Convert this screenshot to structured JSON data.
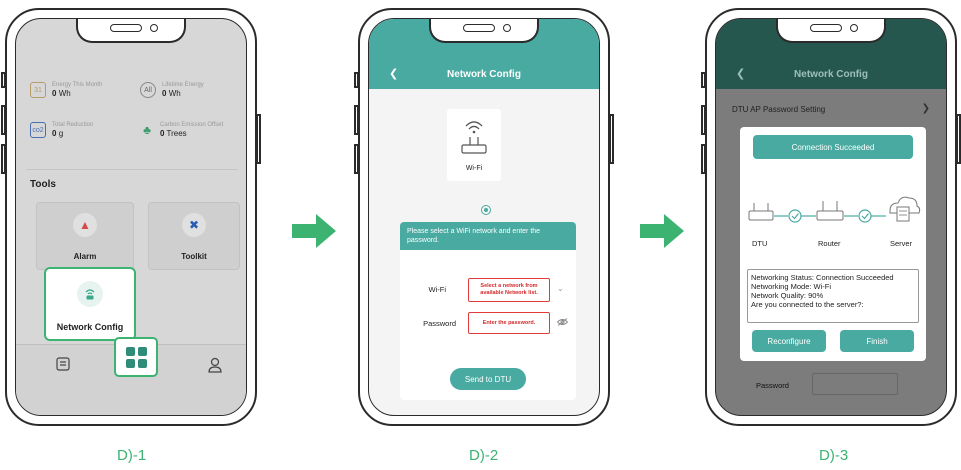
{
  "steps": [
    {
      "caption": "D)-1"
    },
    {
      "caption": "D)-2"
    },
    {
      "caption": "D)-3"
    }
  ],
  "phone1": {
    "stats": [
      {
        "label": "Energy This Month",
        "value": "0",
        "unit": "Wh",
        "icon": "31"
      },
      {
        "label": "Lifetime Energy",
        "value": "0",
        "unit": "Wh",
        "icon": "All"
      },
      {
        "label": "Total Reduction",
        "value": "0",
        "unit": "g",
        "icon": "co2"
      },
      {
        "label": "Carbon Emission Offset",
        "value": "0",
        "unit": "Trees",
        "icon": "tree"
      }
    ],
    "tools_title": "Tools",
    "tools": [
      {
        "label": "Alarm",
        "icon": "alarm-icon"
      },
      {
        "label": "Toolkit",
        "icon": "toolkit-icon"
      },
      {
        "label": "Network Config",
        "icon": "router-wifi-icon"
      }
    ],
    "tabs": [
      "dashboard-icon",
      "apps-icon",
      "user-icon"
    ]
  },
  "phone2": {
    "title": "Network Config",
    "device_label": "Wi-Fi",
    "banner": "Please select a WiFi network and enter the password.",
    "wifi_label": "Wi-Fi",
    "wifi_placeholder": "Select a network from available Network list.",
    "password_label": "Password",
    "password_placeholder": "Enter the password.",
    "send_button": "Send to DTU"
  },
  "phone3": {
    "title": "Network Config",
    "ap_row": "DTU AP Password Setting",
    "password_label": "Password",
    "modal": {
      "status_title": "Connection Succeeded",
      "nodes": [
        "DTU",
        "Router",
        "Server"
      ],
      "status_lines": [
        "Networking Status: Connection Succeeded",
        "Networking Mode: Wi-Fi",
        "Network Quality: 90%",
        "Are you connected to the server?:"
      ],
      "reconfigure_button": "Reconfigure",
      "finish_button": "Finish"
    }
  },
  "colors": {
    "accent": "#48aaa1",
    "highlight": "#3cb371",
    "error": "#e23b3b"
  }
}
